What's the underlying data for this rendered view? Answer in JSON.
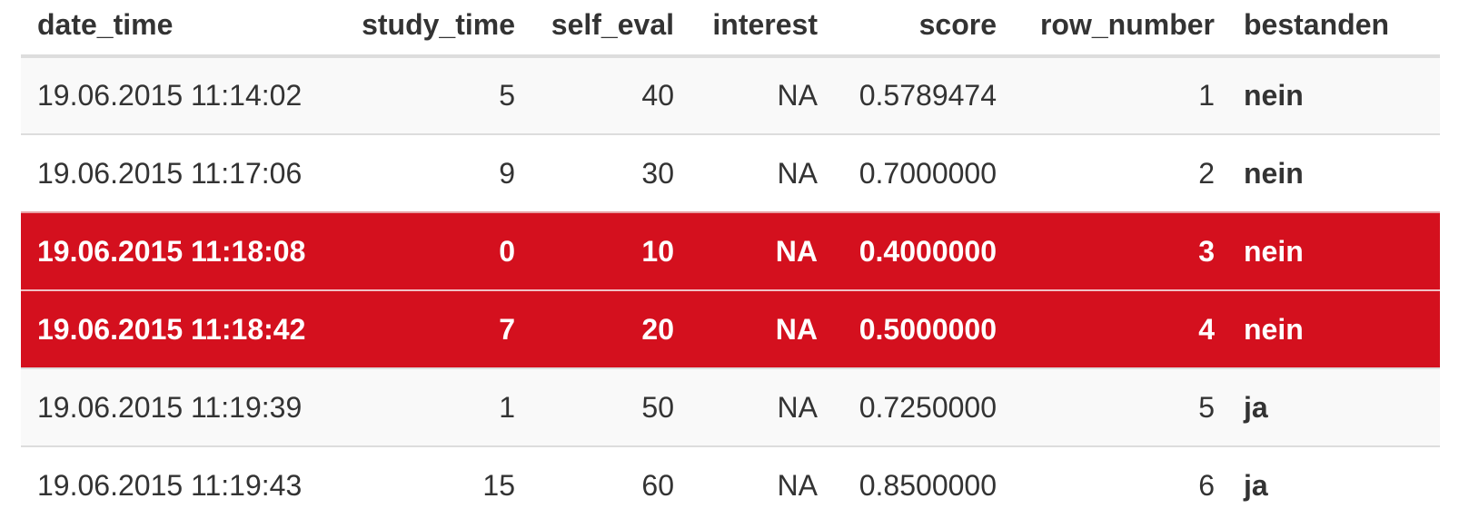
{
  "table": {
    "columns": [
      "date_time",
      "study_time",
      "self_eval",
      "interest",
      "score",
      "row_number",
      "bestanden"
    ],
    "rows": [
      {
        "date_time": "19.06.2015 11:14:02",
        "study_time": "5",
        "self_eval": "40",
        "interest": "NA",
        "score": "0.5789474",
        "row_number": "1",
        "bestanden": "nein",
        "highlighted": false
      },
      {
        "date_time": "19.06.2015 11:17:06",
        "study_time": "9",
        "self_eval": "30",
        "interest": "NA",
        "score": "0.7000000",
        "row_number": "2",
        "bestanden": "nein",
        "highlighted": false
      },
      {
        "date_time": "19.06.2015 11:18:08",
        "study_time": "0",
        "self_eval": "10",
        "interest": "NA",
        "score": "0.4000000",
        "row_number": "3",
        "bestanden": "nein",
        "highlighted": true
      },
      {
        "date_time": "19.06.2015 11:18:42",
        "study_time": "7",
        "self_eval": "20",
        "interest": "NA",
        "score": "0.5000000",
        "row_number": "4",
        "bestanden": "nein",
        "highlighted": true
      },
      {
        "date_time": "19.06.2015 11:19:39",
        "study_time": "1",
        "self_eval": "50",
        "interest": "NA",
        "score": "0.7250000",
        "row_number": "5",
        "bestanden": "ja",
        "highlighted": false
      },
      {
        "date_time": "19.06.2015 11:19:43",
        "study_time": "15",
        "self_eval": "60",
        "interest": "NA",
        "score": "0.8500000",
        "row_number": "6",
        "bestanden": "ja",
        "highlighted": false
      }
    ]
  },
  "colors": {
    "highlight_bg": "#d4101e",
    "highlight_text": "#ffffff",
    "stripe_bg": "#f9f9f9",
    "text": "#333333",
    "border": "#dddddd"
  }
}
